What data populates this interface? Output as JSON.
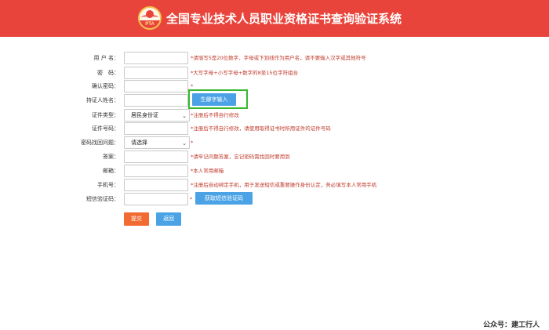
{
  "header": {
    "logo_text": "PTA",
    "title": "全国专业技术人员职业资格证书查询验证系统"
  },
  "form": {
    "username": {
      "label": "用 户 名：",
      "value": "",
      "hint": "*请填写5是20位数字、字母或下划线作为用户名，请不要输入汉字或其他符号"
    },
    "password": {
      "label": "密　码：",
      "value": "",
      "hint": "*大写字母+小写字母+数字的8至15位字符组合"
    },
    "confirm_password": {
      "label": "确认密码：",
      "value": "",
      "hint": "*"
    },
    "holder_name": {
      "label": "持证人姓名：",
      "value": "",
      "rare_char_button": "生僻字输入"
    },
    "id_type": {
      "label": "证件类型：",
      "selected": "居民身份证",
      "hint": "*注册后不得自行修改"
    },
    "id_number": {
      "label": "证件号码：",
      "value": "",
      "hint": "*注册后不得自行修改，请使用取得证书时所用证件的证件号码"
    },
    "security_question": {
      "label": "密码找回问题：",
      "selected": "请选择",
      "hint": "*"
    },
    "answer": {
      "label": "答案：",
      "value": "",
      "hint": "*请牢记问题答案，忘记密码需找回时要用到"
    },
    "email": {
      "label": "邮箱：",
      "value": "",
      "hint": "*本人常用邮箱"
    },
    "phone": {
      "label": "手机号：",
      "value": "",
      "hint": "*注册后自动绑定手机，用于发送短信或重要操作身份认定，务必填写本人常用手机"
    },
    "sms_code": {
      "label": "短信验证码：",
      "value": "",
      "hint": "*",
      "get_code_button": "获取短信验证码"
    }
  },
  "actions": {
    "submit": "提交",
    "back": "返回"
  },
  "watermark": "公众号：建工行人",
  "colors": {
    "header": "#e9443b",
    "primary_button": "#4ba3e6",
    "submit_button": "#f26b32",
    "highlight_box": "#35b82c",
    "hint_text": "#c0392b"
  },
  "icons": {
    "select_caret": "chevron-down-icon",
    "logo": "pta-logo-icon"
  }
}
